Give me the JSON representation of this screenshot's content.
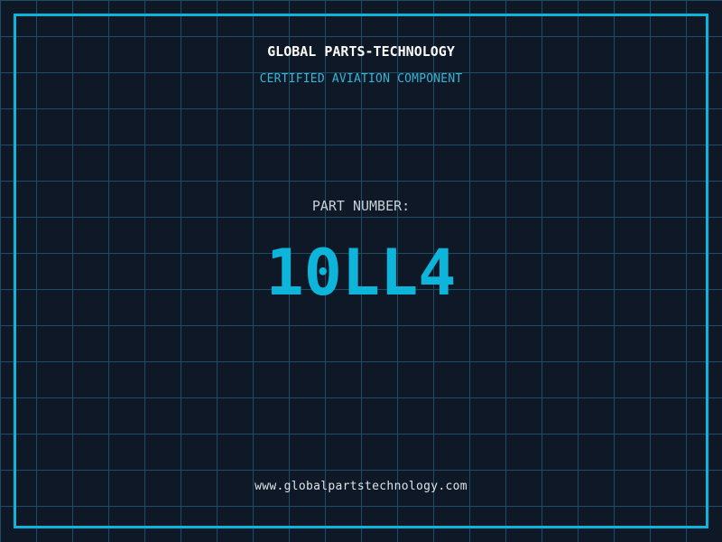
{
  "colors": {
    "background": "#0f1826",
    "grid_line": "#1d4d62",
    "frame": "#0db5da",
    "title": "#fafafa",
    "subtitle": "#33b6d8",
    "label": "#c6cfd8",
    "part_number": "#0db5da",
    "url": "#dbe4ea"
  },
  "header": {
    "title": "GLOBAL PARTS-TECHNOLOGY",
    "subtitle": "CERTIFIED AVIATION COMPONENT"
  },
  "part": {
    "label": "PART NUMBER:",
    "number": "10LL4"
  },
  "footer": {
    "website": "www.globalpartstechnology.com"
  }
}
